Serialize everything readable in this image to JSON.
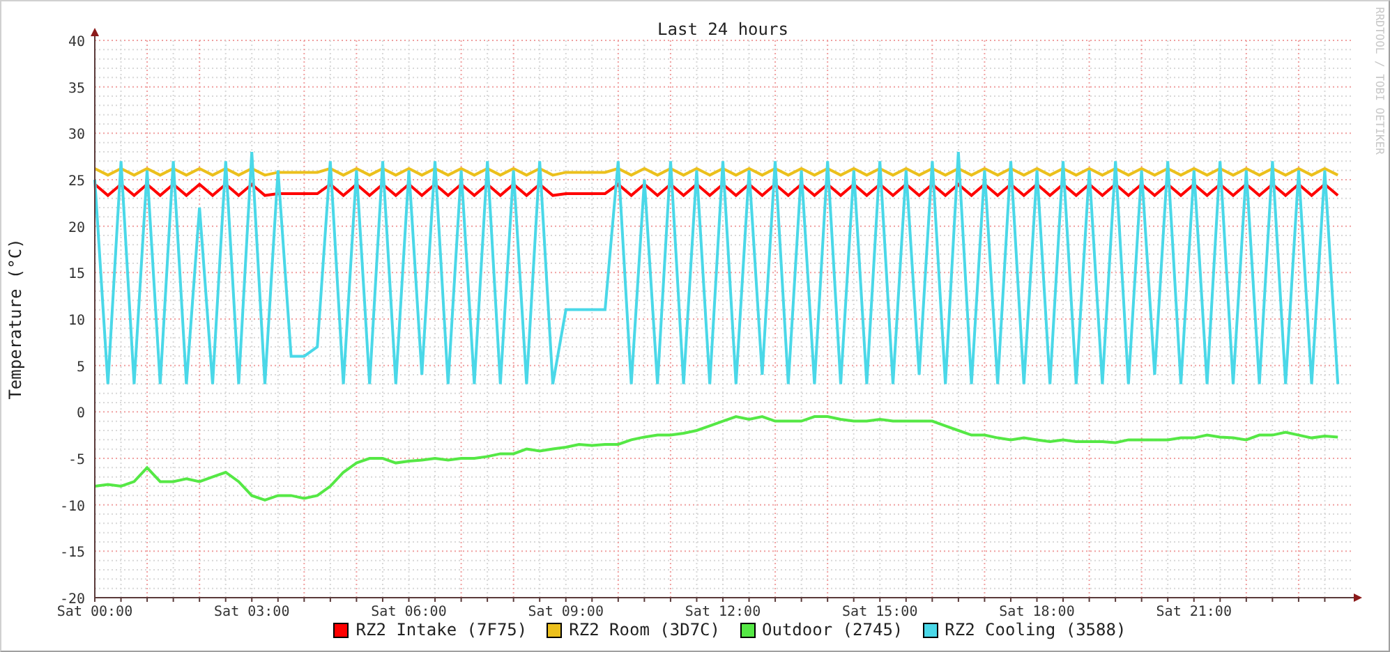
{
  "graph": {
    "vertical_credit": "RRDTOOL / TOBI OETIKER",
    "chart_data": {
      "type": "line",
      "grid": true,
      "title": "Last 24 hours",
      "ylabel": "Temperature (°C)",
      "ylim": [
        -20,
        40
      ],
      "yticks": [
        -20,
        -15,
        -10,
        -5,
        0,
        5,
        10,
        15,
        20,
        25,
        30,
        35,
        40
      ],
      "categories": [
        "Sat 00:00",
        null,
        null,
        null,
        null,
        null,
        null,
        null,
        null,
        null,
        null,
        null,
        "Sat 03:00",
        null,
        null,
        null,
        null,
        null,
        null,
        null,
        null,
        null,
        null,
        null,
        "Sat 06:00",
        null,
        null,
        null,
        null,
        null,
        null,
        null,
        null,
        null,
        null,
        null,
        "Sat 09:00",
        null,
        null,
        null,
        null,
        null,
        null,
        null,
        null,
        null,
        null,
        null,
        "Sat 12:00",
        null,
        null,
        null,
        null,
        null,
        null,
        null,
        null,
        null,
        null,
        null,
        "Sat 15:00",
        null,
        null,
        null,
        null,
        null,
        null,
        null,
        null,
        null,
        null,
        null,
        "Sat 18:00",
        null,
        null,
        null,
        null,
        null,
        null,
        null,
        null,
        null,
        null,
        null,
        "Sat 21:00",
        null,
        null,
        null,
        null,
        null,
        null,
        null,
        null,
        null,
        null,
        null
      ],
      "series": [
        {
          "name": "RZ2 Intake (7F75)",
          "color": "#ff0000",
          "values": [
            24.5,
            23.3,
            24.5,
            23.3,
            24.5,
            23.3,
            24.5,
            23.3,
            24.5,
            23.3,
            24.5,
            23.3,
            24.5,
            23.3,
            23.5,
            23.5,
            23.5,
            23.5,
            24.5,
            23.3,
            24.5,
            23.3,
            24.5,
            23.3,
            24.5,
            23.3,
            24.5,
            23.3,
            24.5,
            23.3,
            24.5,
            23.3,
            24.5,
            23.3,
            24.5,
            23.3,
            23.5,
            23.5,
            23.5,
            23.5,
            24.5,
            23.3,
            24.5,
            23.3,
            24.5,
            23.3,
            24.5,
            23.3,
            24.5,
            23.3,
            24.5,
            23.3,
            24.5,
            23.3,
            24.5,
            23.3,
            24.5,
            23.3,
            24.5,
            23.3,
            24.5,
            23.3,
            24.5,
            23.3,
            24.5,
            23.3,
            24.5,
            23.3,
            24.5,
            23.3,
            24.5,
            23.3,
            24.5,
            23.3,
            24.5,
            23.3,
            24.5,
            23.3,
            24.5,
            23.3,
            24.5,
            23.3,
            24.5,
            23.3,
            24.5,
            23.3,
            24.5,
            23.3,
            24.5,
            23.3,
            24.5,
            23.3,
            24.5,
            23.3,
            24.5,
            23.3
          ]
        },
        {
          "name": "RZ2 Room (3D7C)",
          "color": "#ecc01c",
          "values": [
            26.2,
            25.5,
            26.2,
            25.5,
            26.2,
            25.5,
            26.2,
            25.5,
            26.2,
            25.5,
            26.2,
            25.5,
            26.2,
            25.5,
            25.8,
            25.8,
            25.8,
            25.8,
            26.2,
            25.5,
            26.2,
            25.5,
            26.2,
            25.5,
            26.2,
            25.5,
            26.2,
            25.5,
            26.2,
            25.5,
            26.2,
            25.5,
            26.2,
            25.5,
            26.2,
            25.5,
            25.8,
            25.8,
            25.8,
            25.8,
            26.2,
            25.5,
            26.2,
            25.5,
            26.2,
            25.5,
            26.2,
            25.5,
            26.2,
            25.5,
            26.2,
            25.5,
            26.2,
            25.5,
            26.2,
            25.5,
            26.2,
            25.5,
            26.2,
            25.5,
            26.2,
            25.5,
            26.2,
            25.5,
            26.2,
            25.5,
            26.2,
            25.5,
            26.2,
            25.5,
            26.2,
            25.5,
            26.2,
            25.5,
            26.2,
            25.5,
            26.2,
            25.5,
            26.2,
            25.5,
            26.2,
            25.5,
            26.2,
            25.5,
            26.2,
            25.5,
            26.2,
            25.5,
            26.2,
            25.5,
            26.2,
            25.5,
            26.2,
            25.5,
            26.2,
            25.5
          ]
        },
        {
          "name": "Outdoor (2745)",
          "color": "#55e845",
          "values": [
            -8,
            -7.8,
            -8,
            -7.5,
            -6,
            -7.5,
            -7.5,
            -7.2,
            -7.5,
            -7,
            -6.5,
            -7.5,
            -9,
            -9.5,
            -9,
            -9,
            -9.3,
            -9,
            -8,
            -6.5,
            -5.5,
            -5,
            -5,
            -5.5,
            -5.3,
            -5.2,
            -5,
            -5.2,
            -5,
            -5,
            -4.8,
            -4.5,
            -4.5,
            -4,
            -4.2,
            -4,
            -3.8,
            -3.5,
            -3.6,
            -3.5,
            -3.5,
            -3,
            -2.7,
            -2.5,
            -2.5,
            -2.3,
            -2,
            -1.5,
            -1,
            -0.5,
            -0.8,
            -0.5,
            -1,
            -1,
            -1,
            -0.5,
            -0.5,
            -0.8,
            -1,
            -1,
            -0.8,
            -1,
            -1,
            -1,
            -1,
            -1.5,
            -2,
            -2.5,
            -2.5,
            -2.8,
            -3,
            -2.8,
            -3,
            -3.2,
            -3,
            -3.2,
            -3.2,
            -3.2,
            -3.3,
            -3,
            -3,
            -3,
            -3,
            -2.8,
            -2.8,
            -2.5,
            -2.7,
            -2.8,
            -3,
            -2.5,
            -2.5,
            -2.2,
            -2.5,
            -2.8,
            -2.6,
            -2.7
          ]
        },
        {
          "name": "RZ2 Cooling (3588)",
          "color": "#4ad8e8",
          "values": [
            25,
            3,
            27,
            3,
            26,
            3,
            27,
            3,
            22,
            3,
            27,
            3,
            28,
            3,
            26,
            6,
            6,
            7,
            27,
            3,
            26,
            3,
            27,
            3,
            26,
            4,
            27,
            3,
            26,
            3,
            27,
            3,
            26,
            3,
            27,
            3,
            11,
            11,
            11,
            11,
            27,
            3,
            25,
            3,
            27,
            3,
            26,
            3,
            27,
            3,
            26,
            4,
            27,
            3,
            26,
            3,
            27,
            3,
            26,
            3,
            27,
            3,
            26,
            4,
            27,
            3,
            28,
            3,
            26,
            3,
            27,
            3,
            26,
            3,
            27,
            3,
            26,
            3,
            27,
            3,
            26,
            4,
            27,
            3,
            26,
            3,
            27,
            3,
            26,
            3,
            27,
            3,
            26,
            3,
            26,
            3
          ]
        }
      ]
    }
  }
}
